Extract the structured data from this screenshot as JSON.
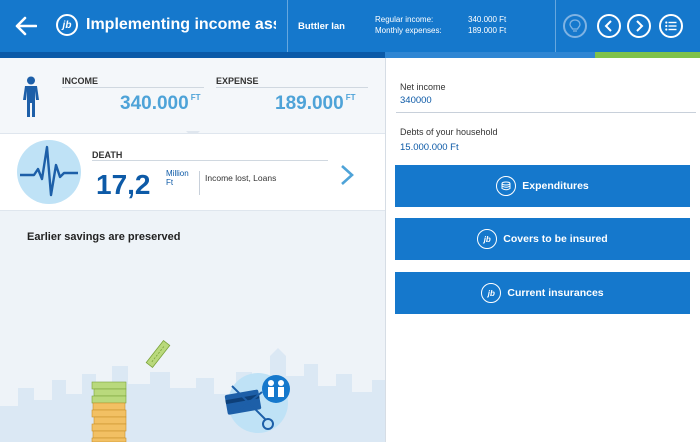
{
  "header": {
    "logo_text": "jb",
    "title": "Implementing income assurance",
    "client": "Buttler Ian",
    "summary": {
      "regular_income_label": "Regular income:",
      "regular_income_value": "340.000 Ft",
      "monthly_expenses_label": "Monthly expenses:",
      "monthly_expenses_value": "189.000 Ft"
    },
    "icons": [
      "back-arrow-icon",
      "lightbulb-icon",
      "chevron-left-icon",
      "chevron-right-icon",
      "list-menu-icon"
    ],
    "colors": {
      "bar": "#1578cc",
      "accent_green": "#7fc14a"
    }
  },
  "left": {
    "income_label": "INCOME",
    "income_value": "340.000",
    "income_unit": "FT",
    "expense_label": "EXPENSE",
    "expense_value": "189.000",
    "expense_unit": "FT",
    "death_label": "DEATH",
    "death_value": "17,2",
    "death_unit_1": "Million",
    "death_unit_2": "Ft",
    "death_desc": "Income lost, Loans",
    "savings_text": "Earlier savings are preserved"
  },
  "right": {
    "net_income_label": "Net income",
    "net_income_value": "340000",
    "debts_label": "Debts of your household",
    "debts_value": "15.000.000 Ft",
    "buttons": [
      {
        "label": "Expenditures",
        "icon": "coins-icon"
      },
      {
        "label": "Covers to be insured",
        "icon": "jb-logo-icon",
        "icon_text": "jb"
      },
      {
        "label": "Current insurances",
        "icon": "jb-logo-icon",
        "icon_text": "jb"
      }
    ]
  }
}
